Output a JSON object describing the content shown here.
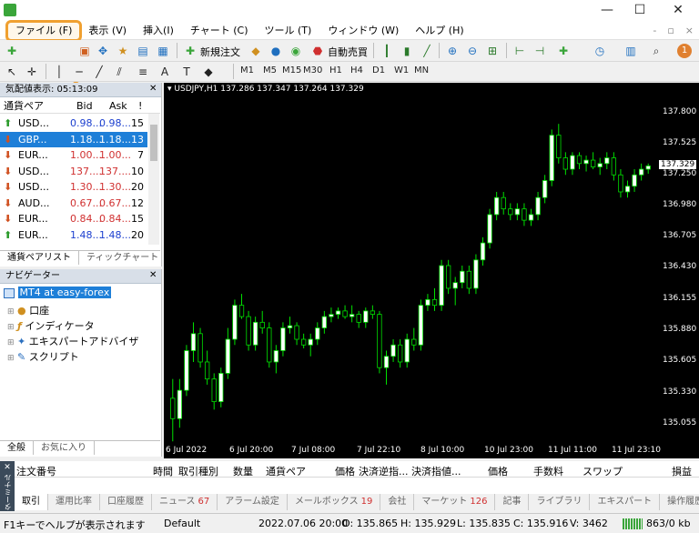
{
  "window": {
    "minimize": "—",
    "maximize": "☐",
    "close": "✕"
  },
  "menu": [
    "ファイル (F)",
    "表示 (V)",
    "挿入(I)",
    "チャート (C)",
    "ツール (T)",
    "ウィンドウ (W)",
    "ヘルプ (H)"
  ],
  "menu_right": {
    "mdi_min": "-",
    "mdi_restore": "▫",
    "mdi_close": "×"
  },
  "toolbar": {
    "new_order": "新規注文",
    "auto_trading": "自動売買",
    "notifications": "1"
  },
  "timeframes": [
    "M1",
    "M5",
    "M15",
    "M30",
    "H1",
    "H4",
    "D1",
    "W1",
    "MN"
  ],
  "market_watch": {
    "title": "気配値表示: 05:13:09",
    "headers": {
      "symbol": "通貨ペア",
      "bid": "Bid",
      "ask": "Ask",
      "spread": "!"
    },
    "rows": [
      {
        "symbol": "USD...",
        "bid": "0.98...",
        "ask": "0.98...",
        "spread": "15",
        "dir": "up"
      },
      {
        "symbol": "GBP...",
        "bid": "1.18...",
        "ask": "1.18...",
        "spread": "13",
        "dir": "dn"
      },
      {
        "symbol": "EUR...",
        "bid": "1.00...",
        "ask": "1.00...",
        "spread": "7",
        "dir": "dn"
      },
      {
        "symbol": "USD...",
        "bid": "137....",
        "ask": "137....",
        "spread": "10",
        "dir": "dn"
      },
      {
        "symbol": "USD...",
        "bid": "1.30...",
        "ask": "1.30...",
        "spread": "20",
        "dir": "dn"
      },
      {
        "symbol": "AUD...",
        "bid": "0.67...",
        "ask": "0.67...",
        "spread": "12",
        "dir": "dn"
      },
      {
        "symbol": "EUR...",
        "bid": "0.84...",
        "ask": "0.84...",
        "spread": "15",
        "dir": "dn"
      },
      {
        "symbol": "EUR...",
        "bid": "1.48...",
        "ask": "1.48...",
        "spread": "20",
        "dir": "up"
      }
    ],
    "tabs": [
      "通貨ペアリスト",
      "ティックチャート"
    ]
  },
  "navigator": {
    "title": "ナビゲーター",
    "root": "MT4 at easy-forex",
    "items": [
      "口座",
      "インディケータ",
      "エキスパートアドバイザ",
      "スクリプト"
    ],
    "tabs": [
      "全般",
      "お気に入り"
    ]
  },
  "chart": {
    "header": "USDJPY,H1  137.286 137.347 137.264 137.329",
    "current_price": "137.329",
    "y_ticks": [
      "137.800",
      "137.525",
      "137.250",
      "136.980",
      "136.705",
      "136.430",
      "136.155",
      "135.880",
      "135.605",
      "135.330",
      "135.055"
    ],
    "x_ticks": [
      "6 Jul 2022",
      "6 Jul 20:00",
      "7 Jul 08:00",
      "7 Jul 22:10",
      "8 Jul 10:00",
      "10 Jul 23:00",
      "11 Jul 11:00",
      "11 Jul 23:10"
    ]
  },
  "terminal": {
    "side_label": "ターミナル",
    "close": "✕",
    "columns": [
      "注文番号",
      "時間",
      "取引種別",
      "数量",
      "通貨ペア",
      "価格",
      "決済逆指...",
      "決済指値...",
      "価格",
      "手数料",
      "スワップ",
      "損益"
    ],
    "tabs": [
      {
        "label": "取引",
        "badge": ""
      },
      {
        "label": "運用比率",
        "badge": ""
      },
      {
        "label": "口座履歴",
        "badge": ""
      },
      {
        "label": "ニュース",
        "badge": "67"
      },
      {
        "label": "アラーム設定",
        "badge": ""
      },
      {
        "label": "メールボックス",
        "badge": "19"
      },
      {
        "label": "会社",
        "badge": ""
      },
      {
        "label": "マーケット",
        "badge": "126"
      },
      {
        "label": "記事",
        "badge": ""
      },
      {
        "label": "ライブラリ",
        "badge": ""
      },
      {
        "label": "エキスパート",
        "badge": ""
      },
      {
        "label": "操作履歴",
        "badge": ""
      }
    ]
  },
  "status": {
    "help": "F1キーでヘルプが表示されます",
    "profile": "Default",
    "datetime": "2022.07.06 20:00",
    "open": "O: 135.865",
    "high": "H: 135.929",
    "low": "L: 135.835",
    "close": "C: 135.916",
    "volume": "V: 3462",
    "traffic": "863/0 kb"
  },
  "chart_data": {
    "type": "candlestick",
    "symbol": "USDJPY",
    "timeframe": "H1",
    "ylim": [
      134.95,
      137.95
    ],
    "x_range": [
      "6 Jul 2022",
      "11 Jul 23:10"
    ],
    "candles_approx": [
      [
        135.28,
        135.45,
        134.9,
        135.1
      ],
      [
        135.1,
        135.45,
        135.02,
        135.35
      ],
      [
        135.35,
        135.75,
        135.3,
        135.7
      ],
      [
        135.7,
        135.95,
        135.6,
        135.85
      ],
      [
        135.85,
        135.9,
        135.55,
        135.6
      ],
      [
        135.6,
        135.7,
        135.4,
        135.45
      ],
      [
        135.45,
        135.5,
        135.18,
        135.25
      ],
      [
        135.25,
        135.55,
        135.2,
        135.5
      ],
      [
        135.5,
        135.9,
        135.45,
        135.8
      ],
      [
        135.8,
        136.15,
        135.75,
        136.1
      ],
      [
        136.1,
        136.2,
        135.98,
        136.0
      ],
      [
        136.0,
        136.05,
        135.7,
        135.75
      ],
      [
        135.75,
        136.0,
        135.7,
        135.95
      ],
      [
        135.95,
        136.05,
        135.85,
        135.9
      ],
      [
        135.9,
        135.95,
        135.55,
        135.6
      ],
      [
        135.6,
        135.75,
        135.5,
        135.7
      ],
      [
        135.7,
        135.95,
        135.65,
        135.9
      ],
      [
        135.9,
        136.0,
        135.85,
        135.92
      ],
      [
        135.92,
        135.95,
        135.75,
        135.8
      ],
      [
        135.8,
        135.85,
        135.72,
        135.75
      ],
      [
        135.75,
        135.85,
        135.65,
        135.8
      ],
      [
        135.8,
        135.95,
        135.75,
        135.9
      ],
      [
        135.9,
        136.05,
        135.85,
        136.0
      ],
      [
        136.0,
        136.08,
        135.95,
        136.02
      ],
      [
        136.02,
        136.08,
        135.98,
        136.05
      ],
      [
        136.05,
        136.1,
        135.98,
        136.0
      ],
      [
        136.0,
        136.1,
        135.95,
        136.02
      ],
      [
        136.02,
        136.05,
        135.9,
        135.95
      ],
      [
        135.95,
        136.08,
        135.9,
        136.05
      ],
      [
        136.05,
        136.1,
        135.98,
        136.02
      ],
      [
        136.02,
        136.05,
        135.5,
        135.55
      ],
      [
        135.55,
        135.7,
        135.4,
        135.65
      ],
      [
        135.65,
        135.8,
        135.6,
        135.75
      ],
      [
        135.75,
        135.8,
        135.55,
        135.6
      ],
      [
        135.6,
        135.85,
        135.55,
        135.8
      ],
      [
        135.8,
        135.9,
        135.7,
        135.75
      ],
      [
        135.75,
        136.15,
        135.7,
        136.1
      ],
      [
        136.1,
        136.2,
        136.05,
        136.15
      ],
      [
        136.15,
        136.25,
        136.05,
        136.1
      ],
      [
        136.1,
        136.5,
        136.05,
        136.45
      ],
      [
        136.45,
        136.5,
        136.2,
        136.25
      ],
      [
        136.25,
        136.35,
        136.1,
        136.3
      ],
      [
        136.3,
        136.45,
        136.25,
        136.4
      ],
      [
        136.4,
        136.45,
        136.2,
        136.25
      ],
      [
        136.25,
        136.55,
        136.2,
        136.5
      ],
      [
        136.5,
        136.7,
        136.45,
        136.65
      ],
      [
        136.65,
        136.95,
        136.6,
        136.9
      ],
      [
        136.9,
        137.1,
        136.85,
        137.05
      ],
      [
        137.05,
        137.1,
        136.9,
        136.95
      ],
      [
        136.95,
        137.0,
        136.85,
        136.9
      ],
      [
        136.9,
        137.0,
        136.85,
        136.95
      ],
      [
        136.95,
        137.0,
        136.8,
        136.85
      ],
      [
        136.85,
        136.95,
        136.8,
        136.9
      ],
      [
        136.9,
        137.1,
        136.85,
        137.05
      ],
      [
        137.05,
        137.25,
        137.0,
        137.2
      ],
      [
        137.2,
        137.65,
        137.15,
        137.6
      ],
      [
        137.6,
        137.7,
        137.35,
        137.4
      ],
      [
        137.4,
        137.45,
        137.25,
        137.3
      ],
      [
        137.3,
        137.45,
        137.25,
        137.42
      ],
      [
        137.42,
        137.45,
        137.3,
        137.35
      ],
      [
        137.35,
        137.42,
        137.28,
        137.38
      ],
      [
        137.38,
        137.45,
        137.3,
        137.32
      ],
      [
        137.32,
        137.4,
        137.25,
        137.35
      ],
      [
        137.35,
        137.45,
        137.3,
        137.4
      ],
      [
        137.4,
        137.45,
        137.2,
        137.25
      ],
      [
        137.25,
        137.3,
        137.05,
        137.1
      ],
      [
        137.1,
        137.2,
        137.05,
        137.15
      ],
      [
        137.15,
        137.3,
        137.1,
        137.25
      ],
      [
        137.25,
        137.35,
        137.2,
        137.3
      ],
      [
        137.3,
        137.35,
        137.26,
        137.329
      ]
    ]
  }
}
